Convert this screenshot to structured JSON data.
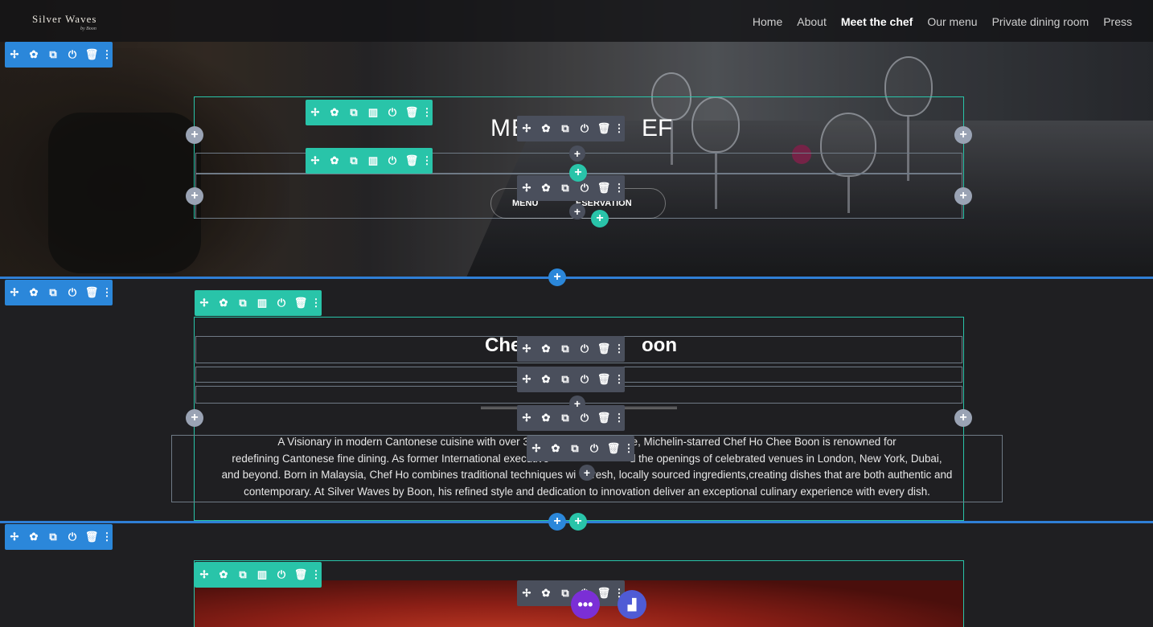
{
  "site": {
    "logo": "Silver Waves",
    "logo_sub": "by Boon",
    "nav": [
      "Home",
      "About",
      "Meet the chef",
      "Our menu",
      "Private dining room",
      "Press"
    ],
    "nav_active": "Meet the chef"
  },
  "hero": {
    "title_visible_start": "ME",
    "title_visible_end": "EF",
    "button_menu": "MENU",
    "button_reservation": "ESERVATION"
  },
  "about": {
    "title_visible_start": "Che",
    "title_visible_end": "oon",
    "bio_lines": [
      "A Visionary in modern Cantonese cuisine with over 35 y",
      "e, Michelin-starred Chef Ho Chee Boon is renowned for",
      "redefining Cantonese fine dining. As former International executive",
      "d the openings of celebrated venues in London, New York, Dubai,",
      "and beyond. Born in Malaysia, Chef Ho combines traditional techniques wi",
      "resh, locally sourced ingredients,creating dishes that are both authentic and",
      "contemporary. At Silver Waves by Boon, his refined style and dedication to innovation deliver an exceptional culinary experience with every dish."
    ]
  },
  "toolbar_icons": {
    "move": "✢",
    "settings": "✿",
    "duplicate": "⧉",
    "columns": "▥",
    "toggle": "⏻",
    "delete": "🗑",
    "more": "⋮"
  },
  "buttons": {
    "plus": "+",
    "fab_more": "•••",
    "fab_chart": "▟"
  },
  "colors": {
    "section_blue": "#2b87da",
    "row_green": "#29c4a9",
    "module_gray": "#4a4f5c",
    "fab_purple": "#7b2fd6"
  }
}
